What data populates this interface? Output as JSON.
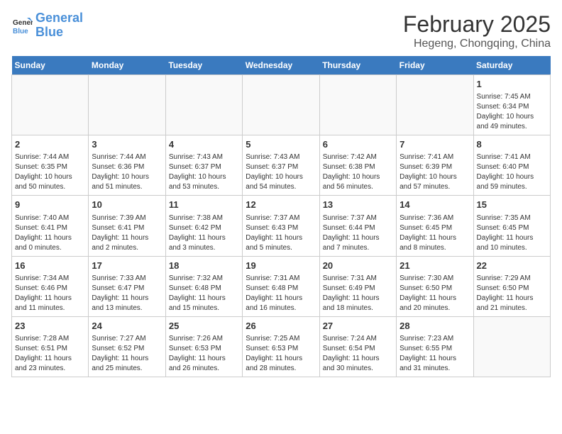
{
  "header": {
    "logo_line1": "General",
    "logo_line2": "Blue",
    "title": "February 2025",
    "subtitle": "Hegeng, Chongqing, China"
  },
  "days_of_week": [
    "Sunday",
    "Monday",
    "Tuesday",
    "Wednesday",
    "Thursday",
    "Friday",
    "Saturday"
  ],
  "weeks": [
    [
      {
        "day": "",
        "info": ""
      },
      {
        "day": "",
        "info": ""
      },
      {
        "day": "",
        "info": ""
      },
      {
        "day": "",
        "info": ""
      },
      {
        "day": "",
        "info": ""
      },
      {
        "day": "",
        "info": ""
      },
      {
        "day": "1",
        "info": "Sunrise: 7:45 AM\nSunset: 6:34 PM\nDaylight: 10 hours\nand 49 minutes."
      }
    ],
    [
      {
        "day": "2",
        "info": "Sunrise: 7:44 AM\nSunset: 6:35 PM\nDaylight: 10 hours\nand 50 minutes."
      },
      {
        "day": "3",
        "info": "Sunrise: 7:44 AM\nSunset: 6:36 PM\nDaylight: 10 hours\nand 51 minutes."
      },
      {
        "day": "4",
        "info": "Sunrise: 7:43 AM\nSunset: 6:37 PM\nDaylight: 10 hours\nand 53 minutes."
      },
      {
        "day": "5",
        "info": "Sunrise: 7:43 AM\nSunset: 6:37 PM\nDaylight: 10 hours\nand 54 minutes."
      },
      {
        "day": "6",
        "info": "Sunrise: 7:42 AM\nSunset: 6:38 PM\nDaylight: 10 hours\nand 56 minutes."
      },
      {
        "day": "7",
        "info": "Sunrise: 7:41 AM\nSunset: 6:39 PM\nDaylight: 10 hours\nand 57 minutes."
      },
      {
        "day": "8",
        "info": "Sunrise: 7:41 AM\nSunset: 6:40 PM\nDaylight: 10 hours\nand 59 minutes."
      }
    ],
    [
      {
        "day": "9",
        "info": "Sunrise: 7:40 AM\nSunset: 6:41 PM\nDaylight: 11 hours\nand 0 minutes."
      },
      {
        "day": "10",
        "info": "Sunrise: 7:39 AM\nSunset: 6:41 PM\nDaylight: 11 hours\nand 2 minutes."
      },
      {
        "day": "11",
        "info": "Sunrise: 7:38 AM\nSunset: 6:42 PM\nDaylight: 11 hours\nand 3 minutes."
      },
      {
        "day": "12",
        "info": "Sunrise: 7:37 AM\nSunset: 6:43 PM\nDaylight: 11 hours\nand 5 minutes."
      },
      {
        "day": "13",
        "info": "Sunrise: 7:37 AM\nSunset: 6:44 PM\nDaylight: 11 hours\nand 7 minutes."
      },
      {
        "day": "14",
        "info": "Sunrise: 7:36 AM\nSunset: 6:45 PM\nDaylight: 11 hours\nand 8 minutes."
      },
      {
        "day": "15",
        "info": "Sunrise: 7:35 AM\nSunset: 6:45 PM\nDaylight: 11 hours\nand 10 minutes."
      }
    ],
    [
      {
        "day": "16",
        "info": "Sunrise: 7:34 AM\nSunset: 6:46 PM\nDaylight: 11 hours\nand 11 minutes."
      },
      {
        "day": "17",
        "info": "Sunrise: 7:33 AM\nSunset: 6:47 PM\nDaylight: 11 hours\nand 13 minutes."
      },
      {
        "day": "18",
        "info": "Sunrise: 7:32 AM\nSunset: 6:48 PM\nDaylight: 11 hours\nand 15 minutes."
      },
      {
        "day": "19",
        "info": "Sunrise: 7:31 AM\nSunset: 6:48 PM\nDaylight: 11 hours\nand 16 minutes."
      },
      {
        "day": "20",
        "info": "Sunrise: 7:31 AM\nSunset: 6:49 PM\nDaylight: 11 hours\nand 18 minutes."
      },
      {
        "day": "21",
        "info": "Sunrise: 7:30 AM\nSunset: 6:50 PM\nDaylight: 11 hours\nand 20 minutes."
      },
      {
        "day": "22",
        "info": "Sunrise: 7:29 AM\nSunset: 6:50 PM\nDaylight: 11 hours\nand 21 minutes."
      }
    ],
    [
      {
        "day": "23",
        "info": "Sunrise: 7:28 AM\nSunset: 6:51 PM\nDaylight: 11 hours\nand 23 minutes."
      },
      {
        "day": "24",
        "info": "Sunrise: 7:27 AM\nSunset: 6:52 PM\nDaylight: 11 hours\nand 25 minutes."
      },
      {
        "day": "25",
        "info": "Sunrise: 7:26 AM\nSunset: 6:53 PM\nDaylight: 11 hours\nand 26 minutes."
      },
      {
        "day": "26",
        "info": "Sunrise: 7:25 AM\nSunset: 6:53 PM\nDaylight: 11 hours\nand 28 minutes."
      },
      {
        "day": "27",
        "info": "Sunrise: 7:24 AM\nSunset: 6:54 PM\nDaylight: 11 hours\nand 30 minutes."
      },
      {
        "day": "28",
        "info": "Sunrise: 7:23 AM\nSunset: 6:55 PM\nDaylight: 11 hours\nand 31 minutes."
      },
      {
        "day": "",
        "info": ""
      }
    ]
  ]
}
